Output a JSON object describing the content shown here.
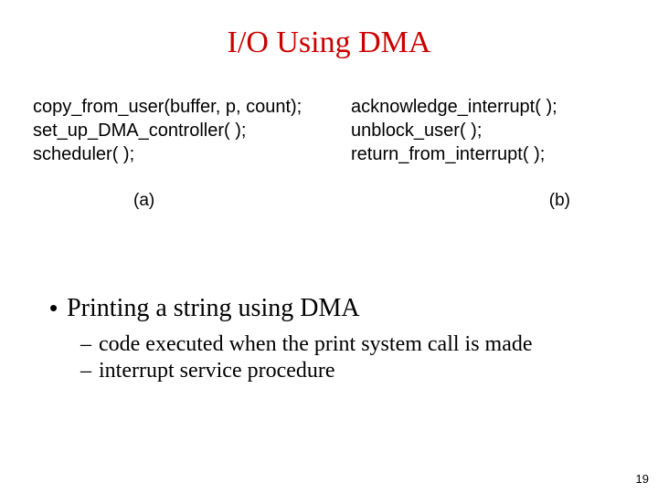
{
  "title": "I/O Using DMA",
  "code": {
    "left": [
      "copy_from_user(buffer, p, count);",
      "set_up_DMA_controller( );",
      "scheduler( );"
    ],
    "right": [
      "acknowledge_interrupt( );",
      "unblock_user( );",
      "return_from_interrupt( );"
    ],
    "label_left": "(a)",
    "label_right": "(b)"
  },
  "bullet": "Printing a string using DMA",
  "subs": [
    "code executed when the print system call is made",
    "interrupt service procedure"
  ],
  "page_number": "19"
}
